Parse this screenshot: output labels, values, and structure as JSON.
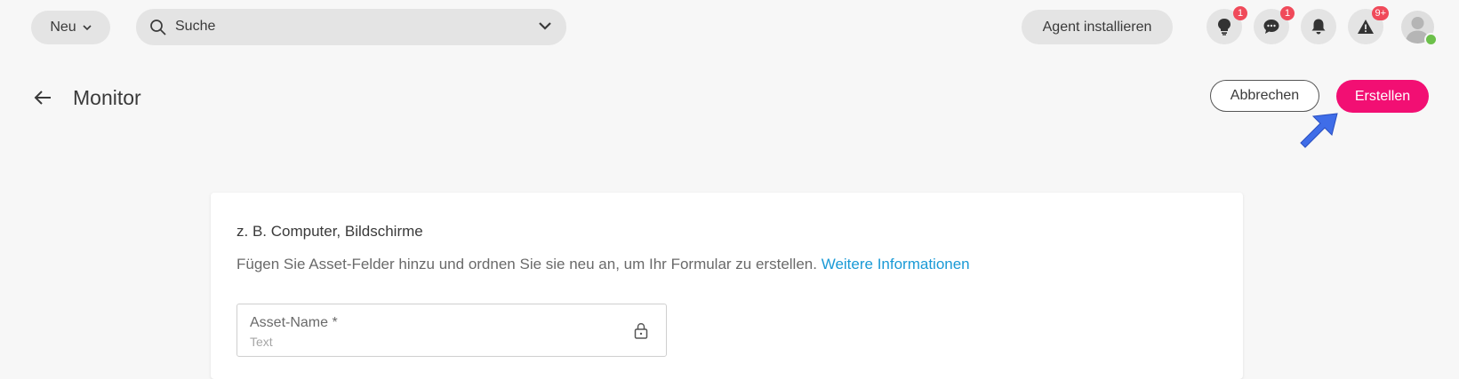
{
  "topbar": {
    "new_label": "Neu",
    "search_placeholder": "Suche",
    "agent_label": "Agent installieren",
    "icons": [
      {
        "name": "lightbulb-icon",
        "badge": "1"
      },
      {
        "name": "chat-icon",
        "badge": "1"
      },
      {
        "name": "bell-icon",
        "badge": ""
      },
      {
        "name": "warning-icon",
        "badge": "9+"
      }
    ]
  },
  "header": {
    "title": "Monitor",
    "cancel_label": "Abbrechen",
    "create_label": "Erstellen"
  },
  "card": {
    "heading": "z. B. Computer, Bildschirme",
    "description": "Fügen Sie Asset-Felder hinzu und ordnen Sie sie neu an, um Ihr Formular zu erstellen.",
    "link_text": "Weitere Informationen",
    "field": {
      "label": "Asset-Name *",
      "type": "Text"
    }
  },
  "colors": {
    "accent": "#f20f73",
    "link": "#1a9ad6",
    "badge": "#f04a5a",
    "pointer": "#3f6de8",
    "online": "#6cc04a"
  }
}
